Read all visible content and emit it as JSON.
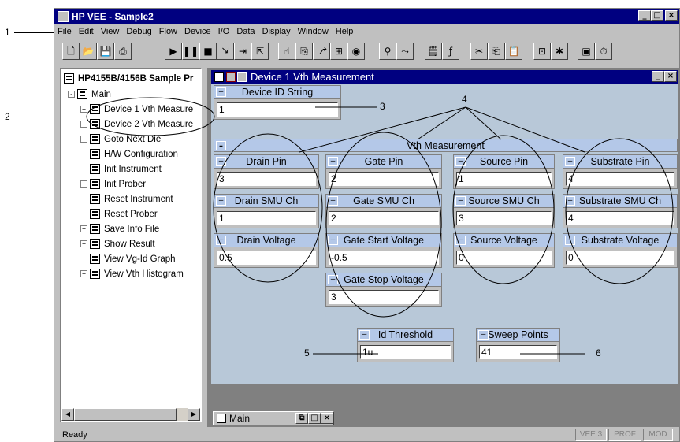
{
  "app": {
    "title": "HP VEE - Sample2"
  },
  "menu": [
    "File",
    "Edit",
    "View",
    "Debug",
    "Flow",
    "Device",
    "I/O",
    "Data",
    "Display",
    "Window",
    "Help"
  ],
  "tree": {
    "root": "HP4155B/4156B Sample Pr",
    "items": [
      {
        "label": "Main",
        "expander": "-"
      },
      {
        "label": "Device 1 Vth Measure",
        "expander": "+"
      },
      {
        "label": "Device 2 Vth Measure",
        "expander": "+"
      },
      {
        "label": "Goto Next Die",
        "expander": "+"
      },
      {
        "label": "H/W Configuration",
        "expander": ""
      },
      {
        "label": "Init Instrument",
        "expander": ""
      },
      {
        "label": "Init Prober",
        "expander": "+"
      },
      {
        "label": "Reset Instrument",
        "expander": ""
      },
      {
        "label": "Reset Prober",
        "expander": ""
      },
      {
        "label": "Save Info File",
        "expander": "+"
      },
      {
        "label": "Show Result",
        "expander": "+"
      },
      {
        "label": "View Vg-Id Graph",
        "expander": ""
      },
      {
        "label": "View Vth Histogram",
        "expander": "+"
      }
    ]
  },
  "device_window": {
    "title": "Device 1 Vth Measurement",
    "device_id": {
      "label": "Device ID String",
      "value": "1"
    },
    "vth_title": "Vth Measurement",
    "drain": [
      {
        "label": "Drain Pin",
        "value": "3"
      },
      {
        "label": "Drain SMU Ch",
        "value": "1"
      },
      {
        "label": "Drain Voltage",
        "value": "0.5"
      }
    ],
    "gate": [
      {
        "label": "Gate Pin",
        "value": "2"
      },
      {
        "label": "Gate SMU Ch",
        "value": "2"
      },
      {
        "label": "Gate Start Voltage",
        "value": "-0.5"
      },
      {
        "label": "Gate Stop Voltage",
        "value": "3"
      }
    ],
    "source": [
      {
        "label": "Source Pin",
        "value": "1"
      },
      {
        "label": "Source SMU Ch",
        "value": "3"
      },
      {
        "label": "Source Voltage",
        "value": "0"
      }
    ],
    "substrate": [
      {
        "label": "Substrate Pin",
        "value": "4"
      },
      {
        "label": "Substrate SMU Ch",
        "value": "4"
      },
      {
        "label": "Substrate Voltage",
        "value": "0"
      }
    ],
    "id_threshold": {
      "label": "Id Threshold",
      "value": "1u"
    },
    "sweep_points": {
      "label": "Sweep Points",
      "value": "41"
    }
  },
  "minimized": {
    "label": "Main"
  },
  "status": {
    "text": "Ready",
    "indicators": [
      "VEE 3",
      "PROF",
      "MOD"
    ]
  },
  "callouts": [
    "1",
    "2",
    "3",
    "4",
    "5",
    "6"
  ]
}
